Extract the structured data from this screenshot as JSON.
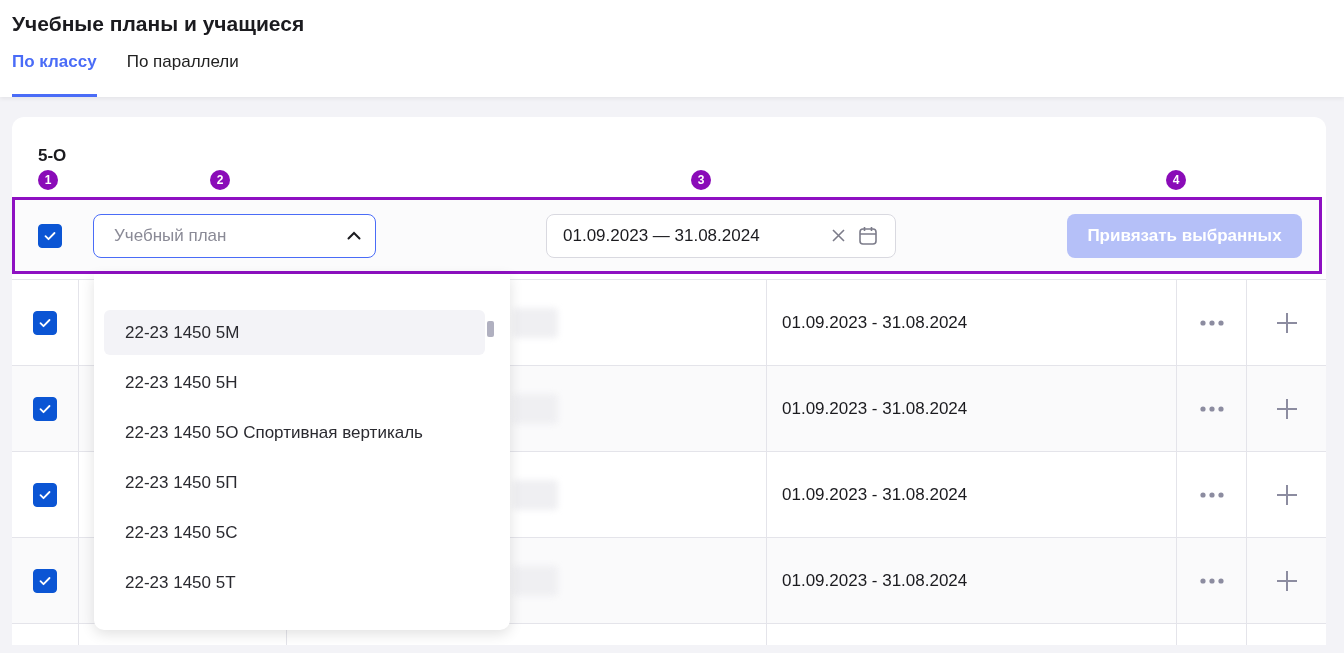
{
  "page": {
    "title": "Учебные планы и учащиеся"
  },
  "tabs": [
    {
      "label": "По классу",
      "selected": true
    },
    {
      "label": "По параллели",
      "selected": false
    }
  ],
  "class_label": "5-О",
  "annotations": [
    {
      "number": "1"
    },
    {
      "number": "2"
    },
    {
      "number": "3"
    },
    {
      "number": "4"
    }
  ],
  "toolbar": {
    "select_all_checked": true,
    "plan_select": {
      "placeholder": "Учебный план",
      "expanded": true
    },
    "date_range": {
      "value": "01.09.2023 — 31.08.2024"
    },
    "bind_button": {
      "label": "Привязать выбранных",
      "disabled": true
    }
  },
  "plan_options": [
    {
      "label": "22-23 1450 5М",
      "selected": true
    },
    {
      "label": "22-23 1450 5Н",
      "selected": false
    },
    {
      "label": "22-23 1450 5О Спортивная вертикаль",
      "selected": false
    },
    {
      "label": "22-23 1450 5П",
      "selected": false
    },
    {
      "label": "22-23 1450 5С",
      "selected": false
    },
    {
      "label": "22-23 1450 5Т",
      "selected": false
    }
  ],
  "rows": [
    {
      "checked": true,
      "period": "01.09.2023 - 31.08.2024"
    },
    {
      "checked": true,
      "period": "01.09.2023 - 31.08.2024"
    },
    {
      "checked": true,
      "period": "01.09.2023 - 31.08.2024"
    },
    {
      "checked": true,
      "period": "01.09.2023 - 31.08.2024"
    }
  ]
}
